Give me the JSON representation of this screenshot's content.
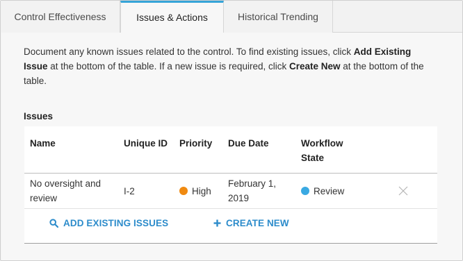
{
  "tabs": [
    {
      "label": "Control Effectiveness"
    },
    {
      "label": "Issues & Actions"
    },
    {
      "label": "Historical Trending"
    }
  ],
  "description": {
    "part1": "Document any known issues related to the control. To find existing issues, click ",
    "bold1": "Add Existing Issue",
    "part2": " at the bottom of the table. If a new issue is required, click ",
    "bold2": "Create New",
    "part3": " at the bottom of the table."
  },
  "issues": {
    "title": "Issues",
    "columns": {
      "name": "Name",
      "unique_id": "Unique ID",
      "priority": "Priority",
      "due_date": "Due Date",
      "workflow_state_line1": "Workflow",
      "workflow_state_line2": "State"
    },
    "rows": [
      {
        "name_line1": "No oversight and",
        "name_line2": "review",
        "unique_id": "I-2",
        "priority": "High",
        "priority_color": "#f08a10",
        "due_date_line1": "February 1,",
        "due_date_line2": "2019",
        "workflow_state": "Review",
        "workflow_color": "#3aa9e2",
        "remove_icon": "close-icon"
      }
    ],
    "actions": {
      "add_existing": "ADD EXISTING ISSUES",
      "create_new": "CREATE NEW"
    }
  },
  "colors": {
    "accent": "#2d8ccb",
    "active_tab_border": "#35a4d8"
  }
}
